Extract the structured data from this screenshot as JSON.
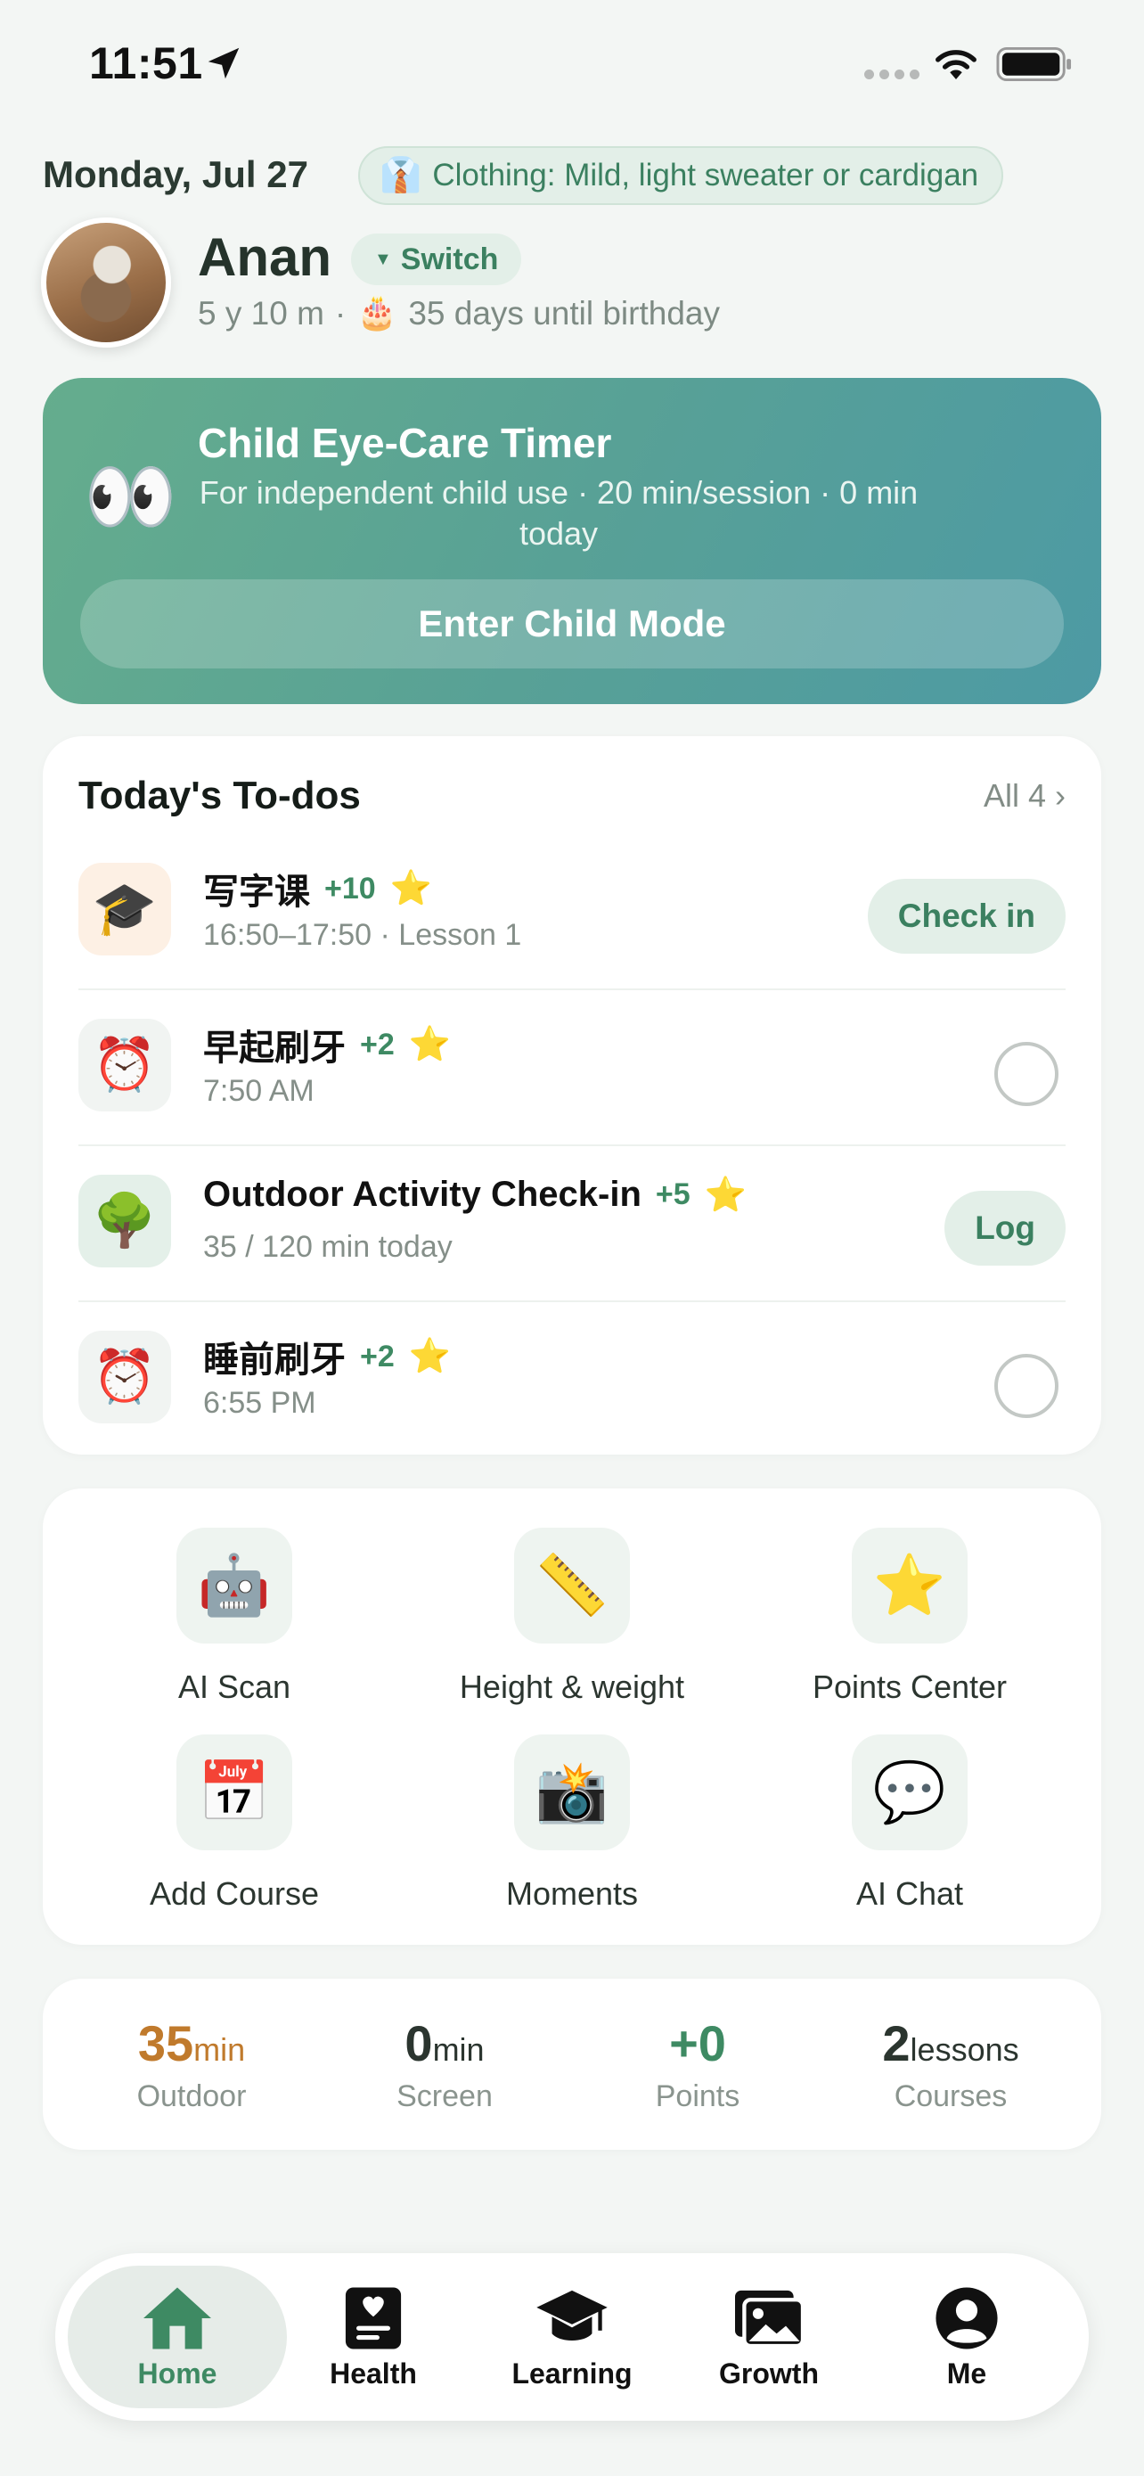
{
  "status_bar": {
    "time": "11:51"
  },
  "header": {
    "date": "Monday, Jul 27",
    "clothing": {
      "emoji": "👔",
      "text": "Clothing: Mild, light sweater or cardigan"
    },
    "child_name": "Anan",
    "switch_label": "Switch",
    "age": "5 y 10 m",
    "separator": "·",
    "birthday_emoji": "🎂",
    "birthday_text": "35 days until birthday"
  },
  "eye_care": {
    "emoji": "👀",
    "title": "Child Eye-Care Timer",
    "subtitle": "For independent child use · 20 min/session · 0 min today",
    "button": "Enter Child Mode"
  },
  "todos": {
    "title": "Today's To-dos",
    "all_link": "All 4 ›",
    "items": [
      {
        "icon": "🎓",
        "name": "写字课",
        "points": "+10",
        "star": "⭐",
        "sub": "16:50–17:50 · Lesson 1",
        "action": "Check in",
        "icon_bg": "#fdf0e4"
      },
      {
        "icon": "⏰",
        "name": "早起刷牙",
        "points": "+2",
        "star": "⭐",
        "sub": "7:50 AM",
        "action": "",
        "icon_bg": "#f1f4f2"
      },
      {
        "icon": "🌳",
        "name": "Outdoor Activity Check-in",
        "points": "+5",
        "star": "⭐",
        "sub": "35 / 120 min today",
        "action": "Log",
        "icon_bg": "#e4f0e9"
      },
      {
        "icon": "⏰",
        "name": "睡前刷牙",
        "points": "+2",
        "star": "⭐",
        "sub": "6:55 PM",
        "action": "",
        "icon_bg": "#f1f4f2"
      }
    ]
  },
  "quick_actions": [
    {
      "icon": "🤖",
      "label": "AI Scan"
    },
    {
      "icon": "📏",
      "label": "Height & weight"
    },
    {
      "icon": "⭐",
      "label": "Points Center"
    },
    {
      "icon": "📅",
      "label": "Add Course"
    },
    {
      "icon": "📸",
      "label": "Moments"
    },
    {
      "icon": "💬",
      "label": "AI Chat"
    }
  ],
  "stats": [
    {
      "value": "35",
      "unit": "min",
      "label": "Outdoor",
      "color": "#c07a2c"
    },
    {
      "value": "0",
      "unit": "min",
      "label": "Screen",
      "color": "#2b352f"
    },
    {
      "value": "+0",
      "unit": "",
      "label": "Points",
      "color": "#3e8a63"
    },
    {
      "value": "2",
      "unit": "lessons",
      "label": "Courses",
      "color": "#2b352f"
    }
  ],
  "tabs": [
    {
      "label": "Home",
      "icon": "home-icon",
      "active": true
    },
    {
      "label": "Health",
      "icon": "health-icon",
      "active": false
    },
    {
      "label": "Learning",
      "icon": "graduation-cap-icon",
      "active": false
    },
    {
      "label": "Growth",
      "icon": "photos-icon",
      "active": false
    },
    {
      "label": "Me",
      "icon": "person-icon",
      "active": false
    }
  ],
  "colors": {
    "accent": "#3e8a63",
    "background": "#f3f6f4"
  }
}
